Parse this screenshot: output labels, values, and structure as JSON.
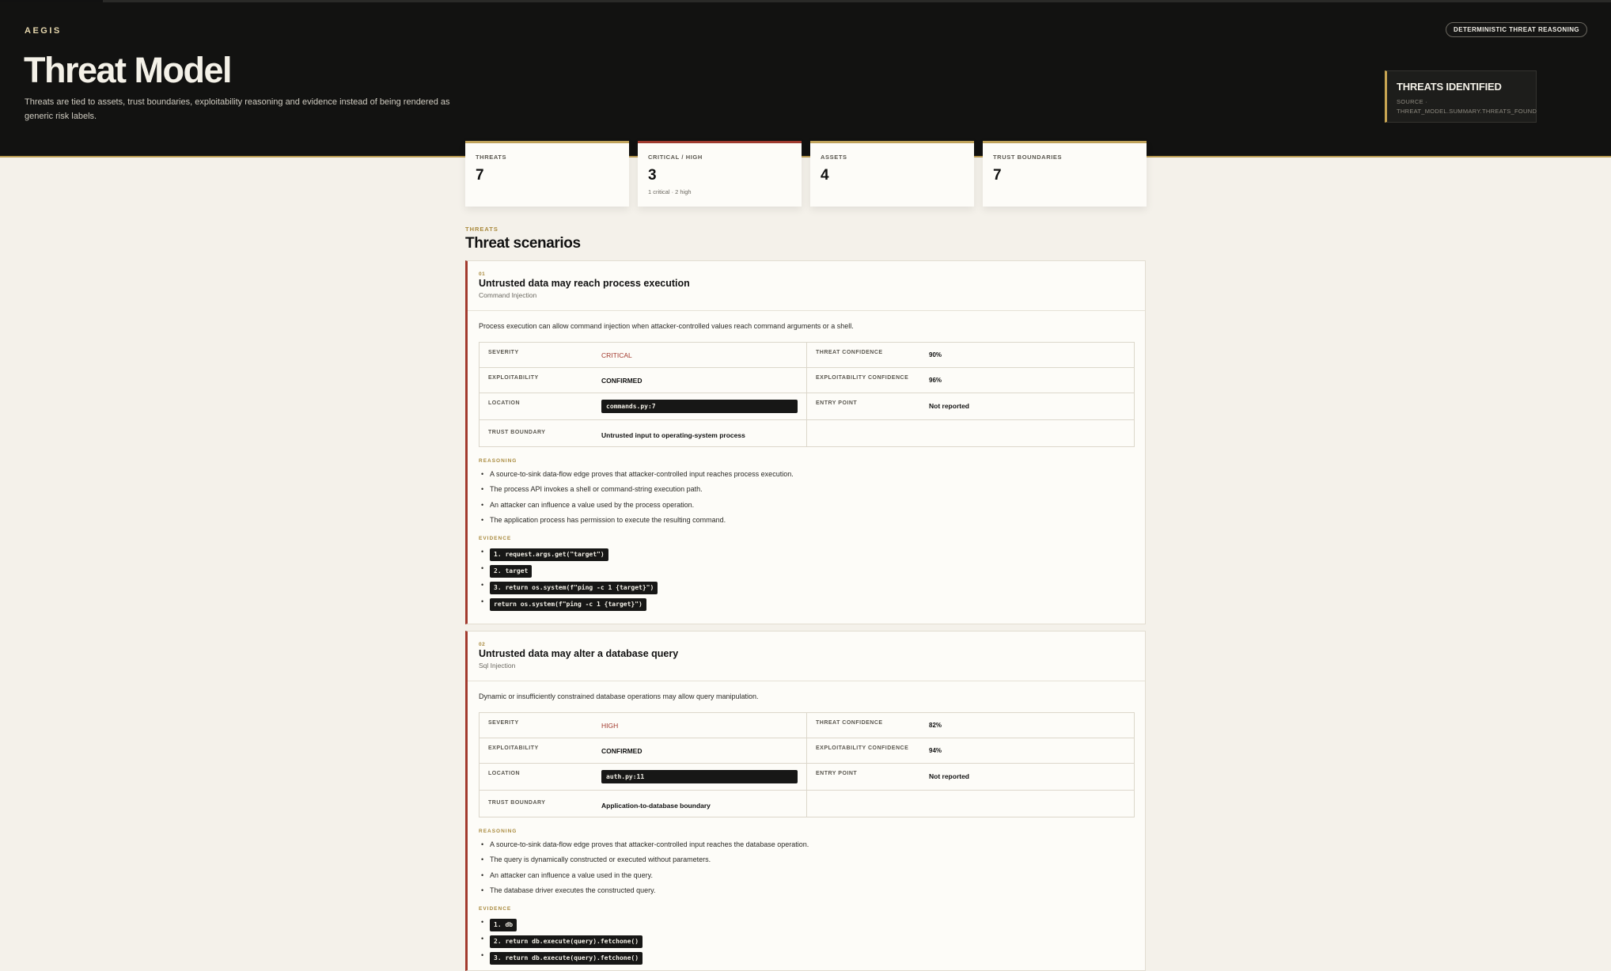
{
  "header": {
    "brand": "AEGIS",
    "title": "Threat Model",
    "description": "Threats are tied to assets, trust boundaries, exploitability reasoning and evidence instead of being rendered as generic risk labels.",
    "badge": "DETERMINISTIC THREAT REASONING",
    "summary_card": {
      "title": "THREATS IDENTIFIED",
      "source": "SOURCE · THREAT_MODEL.SUMMARY.THREATS_FOUND"
    }
  },
  "stats": [
    {
      "label": "THREATS",
      "value": "7",
      "sub": ""
    },
    {
      "label": "CRITICAL / HIGH",
      "value": "3",
      "sub": "1 critical · 2 high"
    },
    {
      "label": "ASSETS",
      "value": "4",
      "sub": ""
    },
    {
      "label": "TRUST BOUNDARIES",
      "value": "7",
      "sub": ""
    }
  ],
  "section": {
    "eyebrow": "THREATS",
    "title": "Threat scenarios"
  },
  "labels": {
    "severity": "SEVERITY",
    "threat_confidence": "THREAT CONFIDENCE",
    "exploitability": "EXPLOITABILITY",
    "exploitability_confidence": "EXPLOITABILITY CONFIDENCE",
    "location": "LOCATION",
    "entry_point": "ENTRY POINT",
    "trust_boundary": "TRUST BOUNDARY",
    "reasoning": "REASONING",
    "evidence": "EVIDENCE"
  },
  "threats": [
    {
      "id": "01",
      "title": "Untrusted data may reach process execution",
      "category": "Command Injection",
      "description": "Process execution can allow command injection when attacker-controlled values reach command arguments or a shell.",
      "severity": "CRITICAL",
      "threat_confidence": "90%",
      "exploitability": "CONFIRMED",
      "exploitability_confidence": "96%",
      "location": "commands.py:7",
      "entry_point": "Not reported",
      "trust_boundary": "Untrusted input to operating-system process",
      "reasoning": [
        "A source-to-sink data-flow edge proves that attacker-controlled input reaches process execution.",
        "The process API invokes a shell or command-string execution path.",
        "An attacker can influence a value used by the process operation.",
        "The application process has permission to execute the resulting command."
      ],
      "evidence": [
        "1. request.args.get(\"target\")",
        "2. target",
        "3. return os.system(f\"ping -c 1 {target}\")",
        "return os.system(f\"ping -c 1 {target}\")"
      ]
    },
    {
      "id": "02",
      "title": "Untrusted data may alter a database query",
      "category": "Sql Injection",
      "description": "Dynamic or insufficiently constrained database operations may allow query manipulation.",
      "severity": "HIGH",
      "threat_confidence": "82%",
      "exploitability": "CONFIRMED",
      "exploitability_confidence": "94%",
      "location": "auth.py:11",
      "entry_point": "Not reported",
      "trust_boundary": "Application-to-database boundary",
      "reasoning": [
        "A source-to-sink data-flow edge proves that attacker-controlled input reaches the database operation.",
        "The query is dynamically constructed or executed without parameters.",
        "An attacker can influence a value used in the query.",
        "The database driver executes the constructed query."
      ],
      "evidence": [
        "1. db",
        "2. return db.execute(query).fetchone()",
        "3. return db.execute(query).fetchone()"
      ]
    }
  ],
  "colors": {
    "accent": "#c9a552",
    "critical": "#a23a2e",
    "hero_bg": "#121211",
    "page_bg": "#f4f1ea"
  }
}
